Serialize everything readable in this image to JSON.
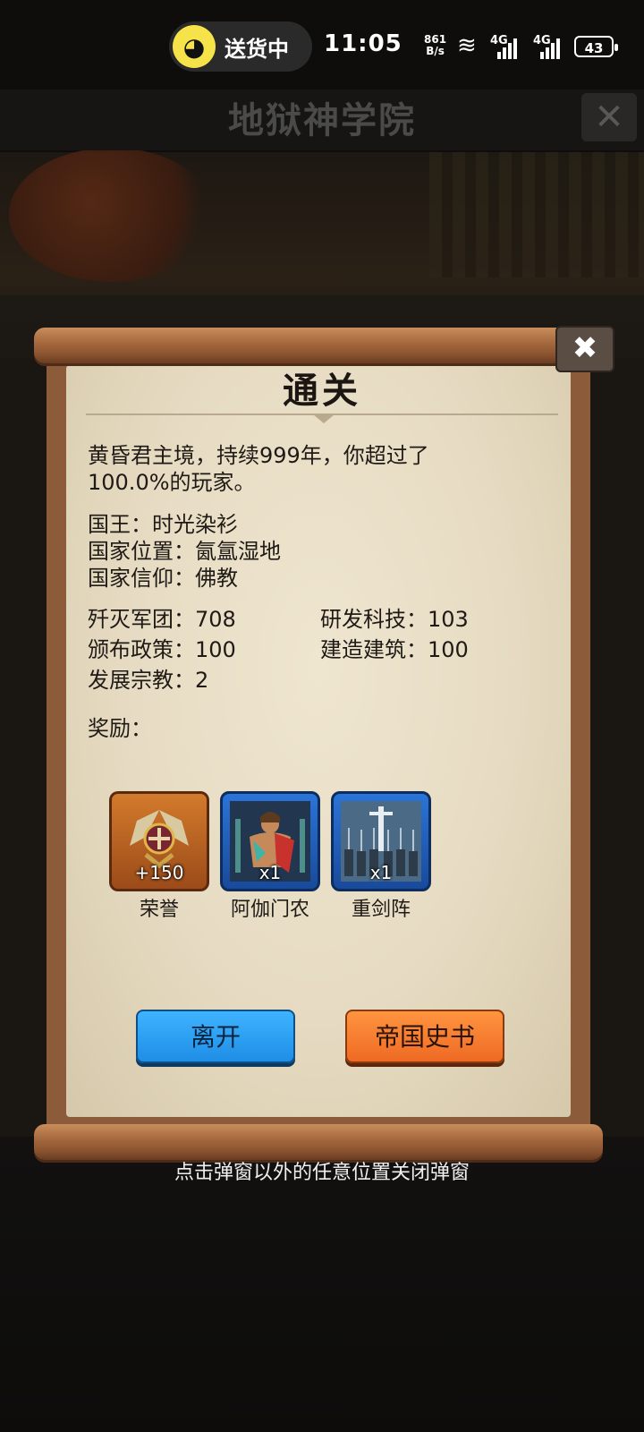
{
  "status_bar": {
    "delivery_label": "送货中",
    "time": "11:05",
    "net_speed_value": "861",
    "net_speed_unit": "B/s",
    "signal1": "4G",
    "signal2": "4G",
    "battery": "43"
  },
  "app": {
    "title": "地狱神学院"
  },
  "dialog": {
    "title": "通关",
    "summary": "黄昏君主境，持续999年，你超过了100.0%的玩家。",
    "king": "国王：时光染衫",
    "location": "国家位置：氤氲湿地",
    "faith": "国家信仰：佛教",
    "stats": [
      {
        "label": "歼灭军团：708"
      },
      {
        "label": "研发科技：103"
      },
      {
        "label": "颁布政策：100"
      },
      {
        "label": "建造建筑：100"
      },
      {
        "label": "发展宗教：2"
      }
    ],
    "rewards_heading": "奖励：",
    "rewards": [
      {
        "name": "荣誉",
        "count": "+150",
        "icon": "honor-emblem-icon",
        "frame": "orange"
      },
      {
        "name": "阿伽门农",
        "count": "x1",
        "icon": "hero-portrait-icon",
        "frame": "blue"
      },
      {
        "name": "重剑阵",
        "count": "x1",
        "icon": "sword-formation-icon",
        "frame": "blue"
      }
    ],
    "buttons": {
      "leave": "离开",
      "history": "帝国史书"
    }
  },
  "hint": "点击弹窗以外的任意位置关闭弹窗",
  "colors": {
    "paper": "#e9dfc7",
    "scroll_wood": "#a86a3f",
    "blue_button": "#2a9cf2",
    "orange_button": "#f47a30"
  }
}
